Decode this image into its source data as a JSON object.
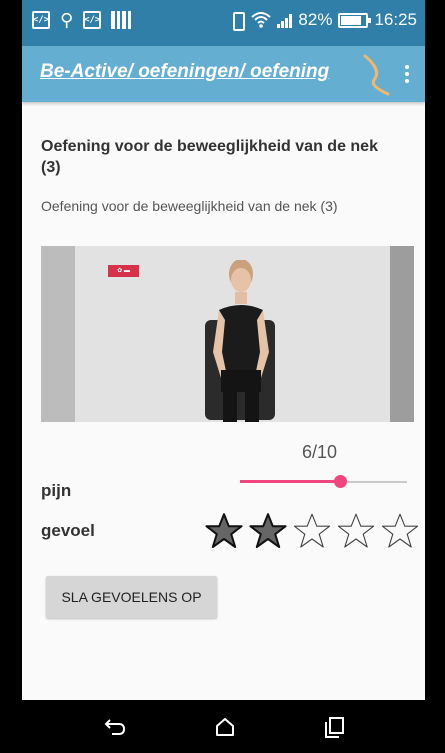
{
  "status_bar": {
    "battery_percent": "82%",
    "battery_level": 0.82,
    "time": "16:25",
    "left_icons": [
      "code-icon",
      "usb-icon",
      "code-icon",
      "bars-icon"
    ],
    "right_icons": [
      "vibrate-icon",
      "wifi-icon",
      "signal-icon",
      "battery-icon"
    ]
  },
  "action_bar": {
    "title": "Be-Active/ oefeningen/ oefening",
    "menu_icon": "overflow-menu-icon"
  },
  "exercise": {
    "title": "Oefening voor de beweeglijkheid van de nek (3)",
    "subtitle": "Oefening voor de beweeglijkheid van de nek (3)"
  },
  "video": {
    "description": "video-thumbnail"
  },
  "pain": {
    "label": "pijn",
    "value_text": "6/10",
    "value": 6,
    "max": 10
  },
  "feeling": {
    "label": "gevoel",
    "rating": 2,
    "max": 5,
    "filled_color": "#666666",
    "empty_color": "#444444"
  },
  "save_button": {
    "label": "SLA GEVOELENS OP"
  },
  "colors": {
    "status_bar": "#2f7fa8",
    "action_bar": "#64aed1",
    "slider_accent": "#f0457e"
  },
  "nav_bar": {
    "icons": [
      "back-icon",
      "home-icon",
      "recents-icon"
    ]
  }
}
